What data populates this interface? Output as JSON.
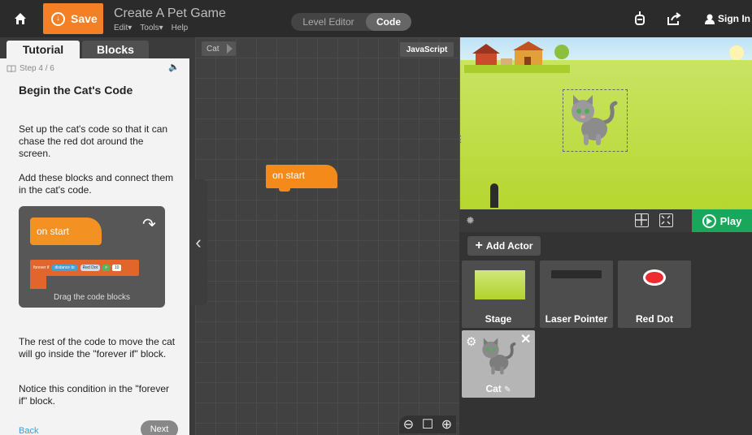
{
  "topbar": {
    "save_label": "Save",
    "project_title": "Create A Pet Game",
    "menus": [
      "Edit",
      "Tools",
      "Help"
    ],
    "mode_options": [
      "Level Editor",
      "Code"
    ],
    "active_mode": "Code",
    "signin_label": "Sign In"
  },
  "tutorial": {
    "tabs": [
      "Tutorial",
      "Blocks"
    ],
    "active_tab": "Tutorial",
    "step": "Step 4 / 6",
    "heading": "Begin the Cat's Code",
    "para1": "Set up the cat's code so that it can chase the red dot around the screen.",
    "para2": "Add these blocks and connect them in the cat's code.",
    "media": {
      "on_start": "on start",
      "forever_if": "forever if",
      "distance_to": "distance to",
      "red_dot": "Red Dot",
      "compare": ">",
      "number": "10",
      "caption": "Drag the code blocks"
    },
    "para3": "The rest of the code to move the cat will go inside the \"forever if\" block.",
    "para4": "Notice this condition in the \"forever if\" block.",
    "back_label": "Back",
    "next_label": "Next"
  },
  "workspace": {
    "breadcrumb": "Cat",
    "language_button": "JavaScript",
    "block_label": "on start"
  },
  "stage": {
    "play_label": "Play"
  },
  "actors": {
    "add_label": "Add Actor",
    "items": [
      "Stage",
      "Laser Pointer",
      "Red Dot",
      "Cat"
    ],
    "selected": "Cat"
  },
  "colors": {
    "accent_orange": "#f47f25",
    "play_green": "#19a85b",
    "block_orange": "#f38a1a",
    "link_blue": "#3a9fd5",
    "red_dot": "#ee2b30"
  },
  "icons": [
    "home-icon",
    "download-icon",
    "chevron-down-icon",
    "robot-icon",
    "share-icon",
    "user-icon",
    "book-icon",
    "speaker-icon",
    "redo-arrow-icon",
    "chevron-left-icon",
    "minus-icon",
    "square-icon",
    "plus-icon",
    "bug-icon",
    "grid-icon",
    "fit-icon",
    "play-icon",
    "gear-icon",
    "close-icon",
    "pencil-icon"
  ]
}
